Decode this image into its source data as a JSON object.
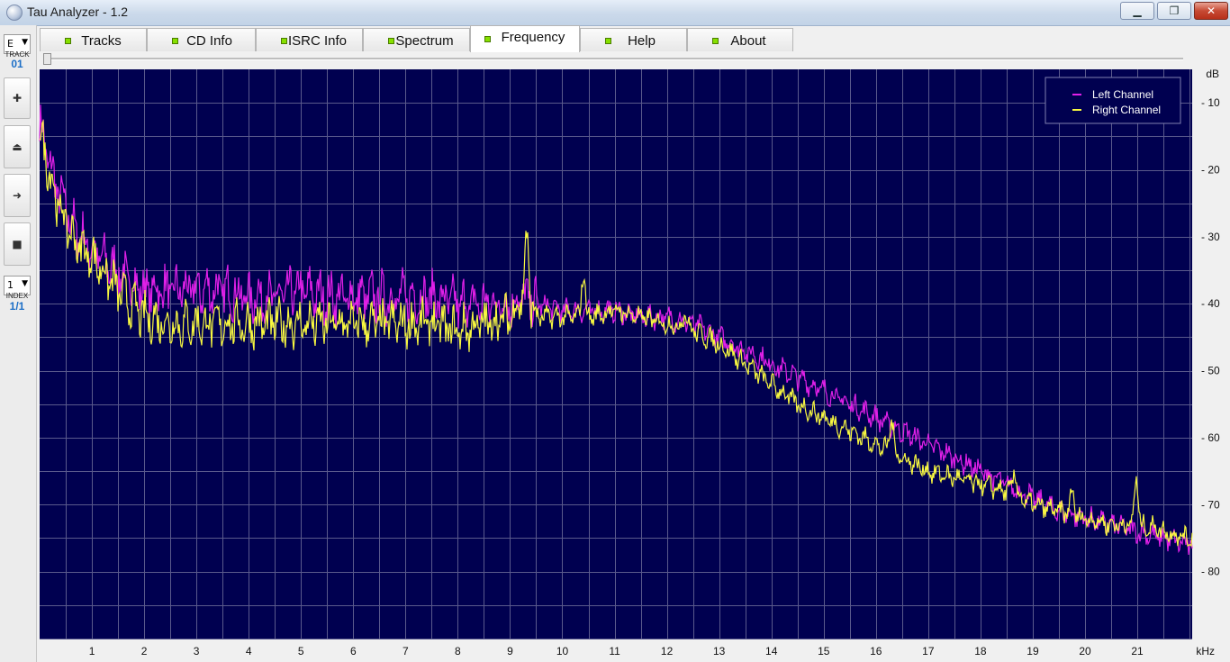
{
  "window": {
    "title": "Tau Analyzer - 1.2",
    "minimize_label": "▁",
    "maximize_label": "❐",
    "close_label": "✕"
  },
  "left_toolbar": {
    "track_combo_value": "E",
    "track_label": "TRACK",
    "track_number": "01",
    "plus_icon_label": "✚",
    "eject_icon_label": "⏏",
    "next_icon_label": "➜",
    "stop_icon_label": "■",
    "index_combo_value": "1",
    "index_label": "INDEX",
    "index_number": "1/1"
  },
  "tabs": [
    {
      "label": "Tracks",
      "active": false
    },
    {
      "label": "CD Info",
      "active": false
    },
    {
      "label": "ISRC Info",
      "active": false
    },
    {
      "label": "Spectrum",
      "active": false
    },
    {
      "label": "Frequency",
      "active": true
    },
    {
      "label": "Help",
      "active": false
    },
    {
      "label": "About",
      "active": false
    }
  ],
  "colors": {
    "plot_bg": "#000050",
    "grid": "#5a5a8c",
    "left_channel": "#e020e8",
    "right_channel": "#f8f840",
    "tab_led": "#86e000"
  },
  "chart_data": {
    "type": "line",
    "title": "",
    "xlabel": "kHz",
    "ylabel": "dB",
    "xlim": [
      0,
      22.05
    ],
    "ylim": [
      -90,
      -5
    ],
    "x_ticks": [
      "1",
      "2",
      "3",
      "4",
      "5",
      "6",
      "7",
      "8",
      "9",
      "10",
      "11",
      "12",
      "13",
      "14",
      "15",
      "16",
      "17",
      "18",
      "19",
      "20",
      "21"
    ],
    "y_ticks": [
      "- 10",
      "- 20",
      "- 30",
      "- 40",
      "- 50",
      "- 60",
      "- 70",
      "- 80"
    ],
    "y_tick_values": [
      -10,
      -20,
      -30,
      -40,
      -50,
      -60,
      -70,
      -80
    ],
    "grid": true,
    "legend_position": "top-right",
    "series": [
      {
        "name": "Left Channel",
        "x": [
          0,
          0.15,
          0.3,
          0.5,
          0.7,
          1,
          1.3,
          1.6,
          2,
          2.5,
          3,
          3.5,
          4,
          4.5,
          5,
          5.5,
          6,
          6.5,
          7,
          7.5,
          8,
          8.5,
          9,
          9.3,
          9.5,
          10,
          10.5,
          11,
          11.5,
          12,
          12.5,
          13,
          13.5,
          14,
          14.5,
          15,
          15.5,
          16,
          16.5,
          17,
          17.5,
          18,
          18.5,
          19,
          19.5,
          20,
          20.5,
          21,
          21.5,
          22
        ],
        "y": [
          -13,
          -18,
          -22,
          -26,
          -29,
          -32,
          -34,
          -36,
          -38,
          -38,
          -38,
          -38,
          -39,
          -39,
          -38,
          -39,
          -39,
          -39,
          -39,
          -39,
          -40,
          -40,
          -40,
          -39,
          -40,
          -41,
          -41,
          -41,
          -42,
          -42,
          -43,
          -45,
          -47,
          -49,
          -51,
          -53,
          -55,
          -57,
          -59,
          -61,
          -63,
          -65,
          -67,
          -69,
          -71,
          -72,
          -73,
          -74,
          -75,
          -76
        ]
      },
      {
        "name": "Right Channel",
        "x": [
          0,
          0.15,
          0.3,
          0.5,
          0.7,
          1,
          1.3,
          1.6,
          2,
          2.5,
          3,
          3.5,
          4,
          4.5,
          5,
          5.5,
          6,
          6.5,
          7,
          7.5,
          8,
          8.5,
          9,
          9.3,
          9.5,
          10,
          10.5,
          11,
          11.5,
          12,
          12.5,
          13,
          13.5,
          14,
          14.5,
          15,
          15.5,
          16,
          16.5,
          17,
          17.5,
          18,
          18.5,
          19,
          19.5,
          20,
          20.5,
          21,
          21.5,
          22
        ],
        "y": [
          -14,
          -19,
          -24,
          -28,
          -31,
          -33,
          -36,
          -39,
          -42,
          -43,
          -43,
          -43,
          -43,
          -43,
          -43,
          -43,
          -43,
          -43,
          -43,
          -43,
          -44,
          -43,
          -42,
          -38,
          -42,
          -42,
          -42,
          -41,
          -42,
          -43,
          -44,
          -46,
          -49,
          -52,
          -55,
          -57,
          -59,
          -61,
          -63,
          -65,
          -66,
          -67,
          -68,
          -70,
          -71,
          -72,
          -73,
          -73,
          -74,
          -75
        ]
      }
    ],
    "peaks_right": [
      {
        "x": 9.32,
        "y": -30.5
      },
      {
        "x": 10.4,
        "y": -35.5
      },
      {
        "x": 12.35,
        "y": -41
      },
      {
        "x": 16.3,
        "y": -57
      },
      {
        "x": 18.65,
        "y": -65
      },
      {
        "x": 19.75,
        "y": -68
      },
      {
        "x": 20.98,
        "y": -66
      },
      {
        "x": 21.35,
        "y": -73
      }
    ]
  }
}
